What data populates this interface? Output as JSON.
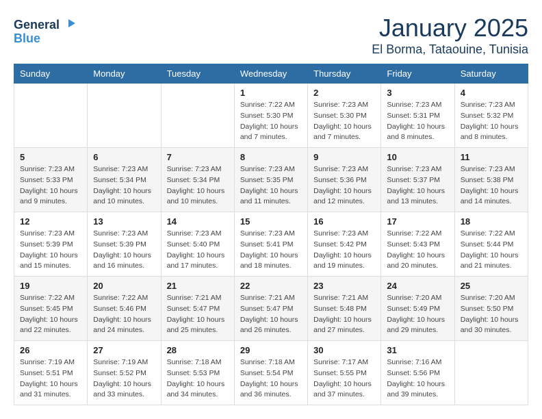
{
  "header": {
    "logo_general": "General",
    "logo_blue": "Blue",
    "title": "January 2025",
    "subtitle": "El Borma, Tataouine, Tunisia"
  },
  "calendar": {
    "days_of_week": [
      "Sunday",
      "Monday",
      "Tuesday",
      "Wednesday",
      "Thursday",
      "Friday",
      "Saturday"
    ],
    "weeks": [
      [
        {
          "day": "",
          "info": ""
        },
        {
          "day": "",
          "info": ""
        },
        {
          "day": "",
          "info": ""
        },
        {
          "day": "1",
          "info": "Sunrise: 7:22 AM\nSunset: 5:30 PM\nDaylight: 10 hours\nand 7 minutes."
        },
        {
          "day": "2",
          "info": "Sunrise: 7:23 AM\nSunset: 5:30 PM\nDaylight: 10 hours\nand 7 minutes."
        },
        {
          "day": "3",
          "info": "Sunrise: 7:23 AM\nSunset: 5:31 PM\nDaylight: 10 hours\nand 8 minutes."
        },
        {
          "day": "4",
          "info": "Sunrise: 7:23 AM\nSunset: 5:32 PM\nDaylight: 10 hours\nand 8 minutes."
        }
      ],
      [
        {
          "day": "5",
          "info": "Sunrise: 7:23 AM\nSunset: 5:33 PM\nDaylight: 10 hours\nand 9 minutes."
        },
        {
          "day": "6",
          "info": "Sunrise: 7:23 AM\nSunset: 5:34 PM\nDaylight: 10 hours\nand 10 minutes."
        },
        {
          "day": "7",
          "info": "Sunrise: 7:23 AM\nSunset: 5:34 PM\nDaylight: 10 hours\nand 10 minutes."
        },
        {
          "day": "8",
          "info": "Sunrise: 7:23 AM\nSunset: 5:35 PM\nDaylight: 10 hours\nand 11 minutes."
        },
        {
          "day": "9",
          "info": "Sunrise: 7:23 AM\nSunset: 5:36 PM\nDaylight: 10 hours\nand 12 minutes."
        },
        {
          "day": "10",
          "info": "Sunrise: 7:23 AM\nSunset: 5:37 PM\nDaylight: 10 hours\nand 13 minutes."
        },
        {
          "day": "11",
          "info": "Sunrise: 7:23 AM\nSunset: 5:38 PM\nDaylight: 10 hours\nand 14 minutes."
        }
      ],
      [
        {
          "day": "12",
          "info": "Sunrise: 7:23 AM\nSunset: 5:39 PM\nDaylight: 10 hours\nand 15 minutes."
        },
        {
          "day": "13",
          "info": "Sunrise: 7:23 AM\nSunset: 5:39 PM\nDaylight: 10 hours\nand 16 minutes."
        },
        {
          "day": "14",
          "info": "Sunrise: 7:23 AM\nSunset: 5:40 PM\nDaylight: 10 hours\nand 17 minutes."
        },
        {
          "day": "15",
          "info": "Sunrise: 7:23 AM\nSunset: 5:41 PM\nDaylight: 10 hours\nand 18 minutes."
        },
        {
          "day": "16",
          "info": "Sunrise: 7:23 AM\nSunset: 5:42 PM\nDaylight: 10 hours\nand 19 minutes."
        },
        {
          "day": "17",
          "info": "Sunrise: 7:22 AM\nSunset: 5:43 PM\nDaylight: 10 hours\nand 20 minutes."
        },
        {
          "day": "18",
          "info": "Sunrise: 7:22 AM\nSunset: 5:44 PM\nDaylight: 10 hours\nand 21 minutes."
        }
      ],
      [
        {
          "day": "19",
          "info": "Sunrise: 7:22 AM\nSunset: 5:45 PM\nDaylight: 10 hours\nand 22 minutes."
        },
        {
          "day": "20",
          "info": "Sunrise: 7:22 AM\nSunset: 5:46 PM\nDaylight: 10 hours\nand 24 minutes."
        },
        {
          "day": "21",
          "info": "Sunrise: 7:21 AM\nSunset: 5:47 PM\nDaylight: 10 hours\nand 25 minutes."
        },
        {
          "day": "22",
          "info": "Sunrise: 7:21 AM\nSunset: 5:47 PM\nDaylight: 10 hours\nand 26 minutes."
        },
        {
          "day": "23",
          "info": "Sunrise: 7:21 AM\nSunset: 5:48 PM\nDaylight: 10 hours\nand 27 minutes."
        },
        {
          "day": "24",
          "info": "Sunrise: 7:20 AM\nSunset: 5:49 PM\nDaylight: 10 hours\nand 29 minutes."
        },
        {
          "day": "25",
          "info": "Sunrise: 7:20 AM\nSunset: 5:50 PM\nDaylight: 10 hours\nand 30 minutes."
        }
      ],
      [
        {
          "day": "26",
          "info": "Sunrise: 7:19 AM\nSunset: 5:51 PM\nDaylight: 10 hours\nand 31 minutes."
        },
        {
          "day": "27",
          "info": "Sunrise: 7:19 AM\nSunset: 5:52 PM\nDaylight: 10 hours\nand 33 minutes."
        },
        {
          "day": "28",
          "info": "Sunrise: 7:18 AM\nSunset: 5:53 PM\nDaylight: 10 hours\nand 34 minutes."
        },
        {
          "day": "29",
          "info": "Sunrise: 7:18 AM\nSunset: 5:54 PM\nDaylight: 10 hours\nand 36 minutes."
        },
        {
          "day": "30",
          "info": "Sunrise: 7:17 AM\nSunset: 5:55 PM\nDaylight: 10 hours\nand 37 minutes."
        },
        {
          "day": "31",
          "info": "Sunrise: 7:16 AM\nSunset: 5:56 PM\nDaylight: 10 hours\nand 39 minutes."
        },
        {
          "day": "",
          "info": ""
        }
      ]
    ]
  }
}
